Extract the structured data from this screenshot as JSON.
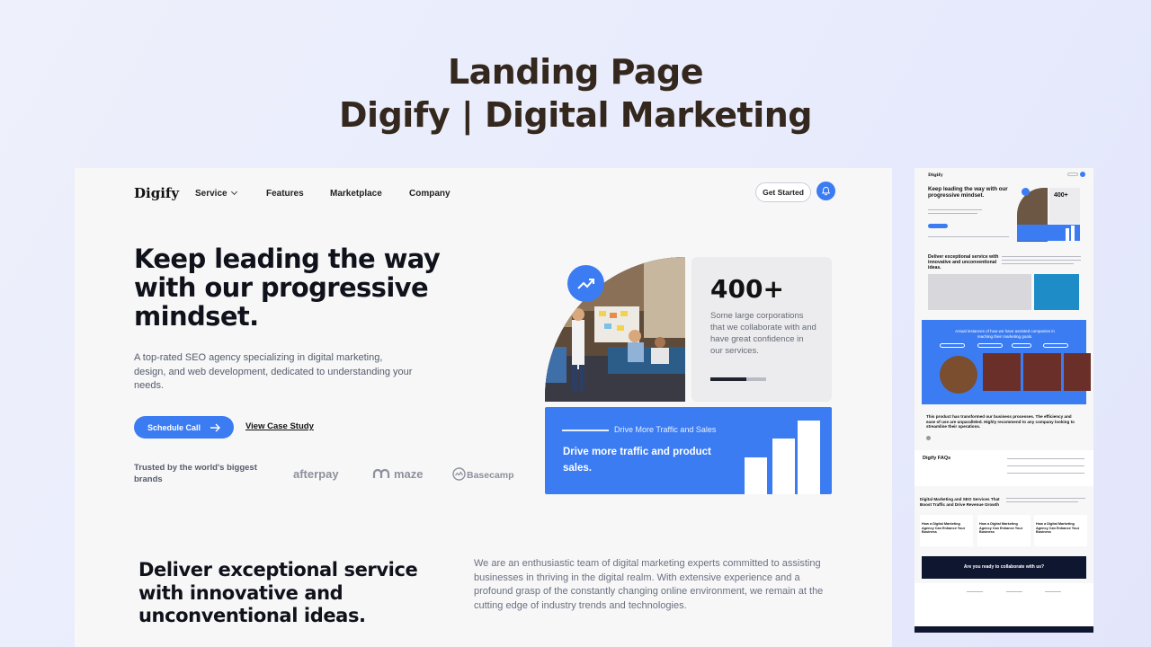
{
  "heading": {
    "line1": "Landing Page",
    "line2": "Digify | Digital Marketing"
  },
  "nav": {
    "logo": "Digify",
    "items": [
      "Service",
      "Features",
      "Marketplace",
      "Company"
    ],
    "get_started": "Get Started"
  },
  "hero": {
    "headline": "Keep leading the way with our progressive mindset.",
    "description": "A top-rated SEO agency specializing in digital marketing, design, and web development, dedicated to understanding your needs.",
    "schedule_call": "Schedule Call",
    "case_study": "View Case Study",
    "trusted": "Trusted by the world's biggest brands",
    "brands": [
      "afterpay",
      "maze",
      "Basecamp"
    ]
  },
  "stat": {
    "number": "400+",
    "text": "Some large corporations that we collaborate with and have great confidence in our services."
  },
  "traffic_card": {
    "label": "Drive More Traffic and Sales",
    "title": "Drive more traffic and product sales."
  },
  "section": {
    "headline": "Deliver exceptional service with innovative and unconventional ideas.",
    "text": "We are an enthusiastic team of digital marketing experts committed to assisting businesses in thriving in the digital realm. With extensive experience and a profound grasp of the constantly changing online environment, we remain at the cutting edge of industry trends and technologies."
  },
  "thumbnail": {
    "logo": "Digify",
    "hero": "Keep leading the way with our progressive mindset.",
    "stat": "400+",
    "deliver": "Deliver exceptional service with innovative and unconventional ideas.",
    "testimonial_heading": "Actual instances of how we have assisted companies in reaching their marketing goals.",
    "quote": "This product has transformed our business processes. The efficiency and ease of use are unparalleled. Highly recommend to any company looking to streamline their operations.",
    "faq": "Digify FAQs",
    "services": "Digital Marketing and SEO Services That Boost Traffic and Drive Revenue Growth",
    "blog_card": "How a Digital Marketing Agency Can Enhance Your Business",
    "cta": "Are you ready to collaborate with us?"
  },
  "colors": {
    "accent": "#3b7cf3",
    "heading": "#34271d",
    "dark": "#10121b"
  }
}
